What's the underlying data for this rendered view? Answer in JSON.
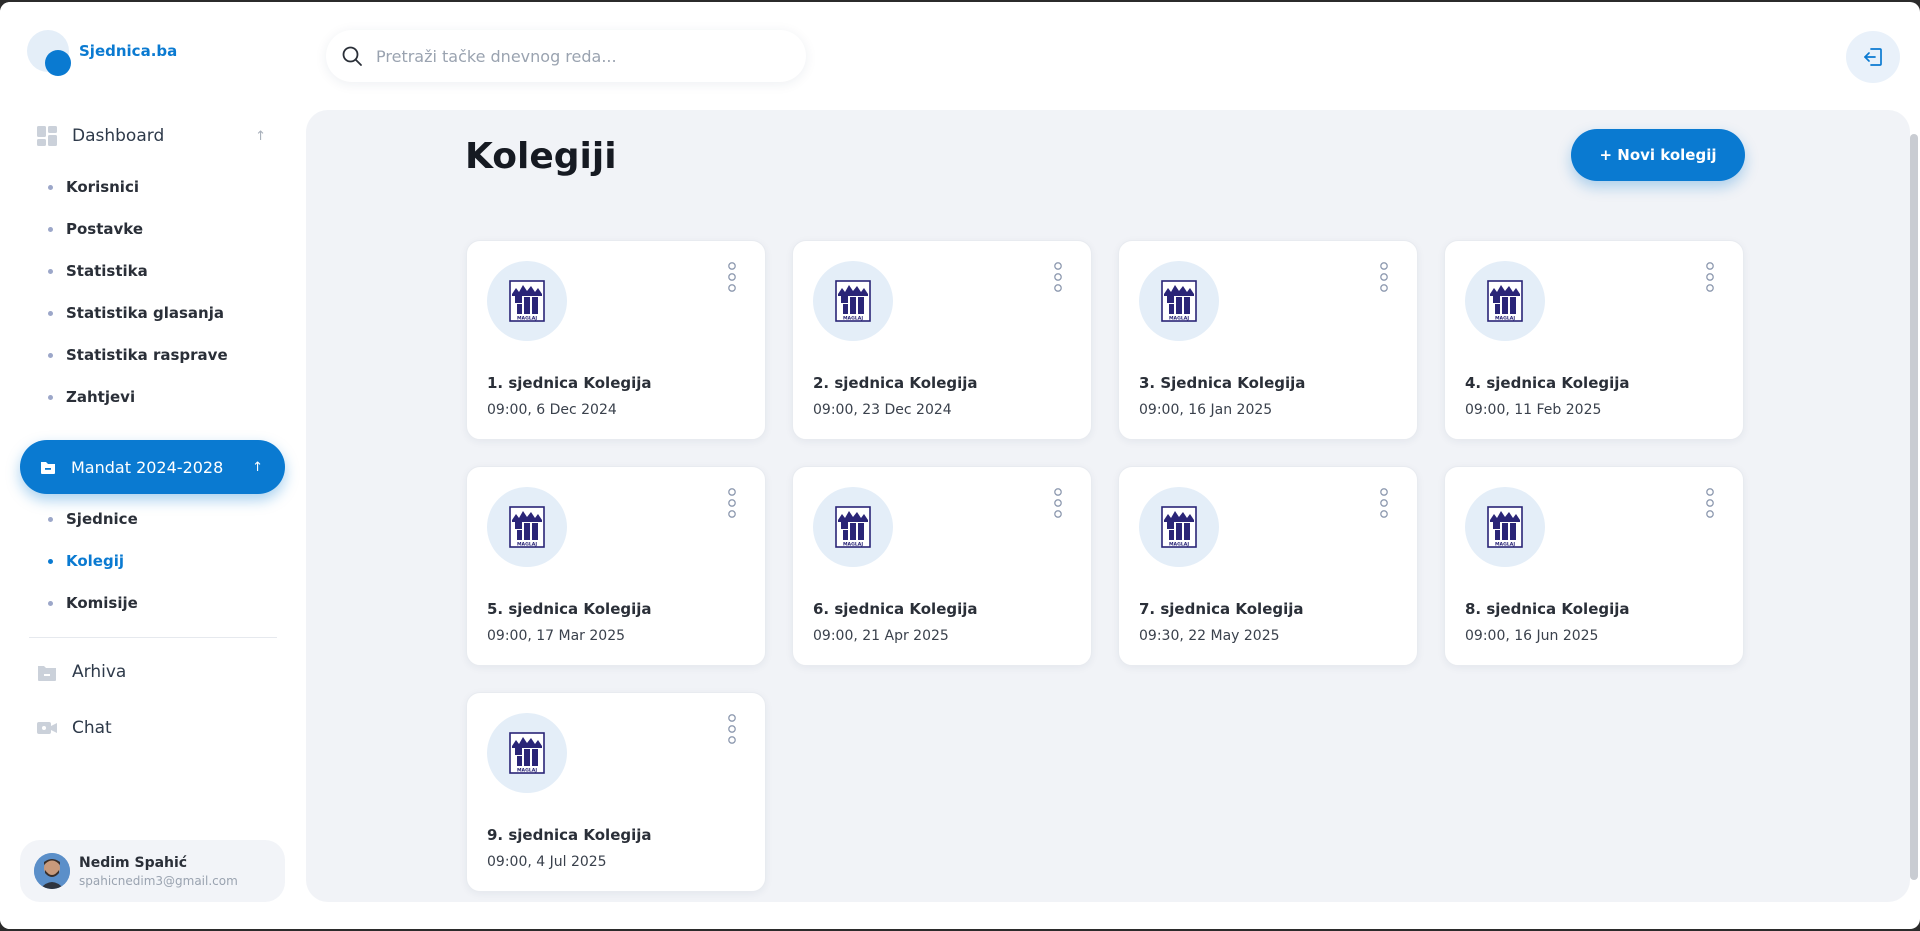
{
  "brand": "Sjednica.ba",
  "search": {
    "placeholder": "Pretraži tačke dnevnog reda..."
  },
  "sidebar": {
    "dashboard": {
      "label": "Dashboard"
    },
    "dashboard_items": [
      "Korisnici",
      "Postavke",
      "Statistika",
      "Statistika glasanja",
      "Statistika rasprave",
      "Zahtjevi"
    ],
    "mandat": {
      "label": "Mandat 2024-2028"
    },
    "mandat_items": [
      "Sjednice",
      "Kolegij",
      "Komisije"
    ],
    "mandat_active": "Kolegij",
    "arhiva": {
      "label": "Arhiva"
    },
    "chat": {
      "label": "Chat"
    }
  },
  "user": {
    "name": "Nedim Spahić",
    "email": "spahicnedim3@gmail.com"
  },
  "main": {
    "title": "Kolegiji",
    "new_button": "+ Novi kolegij",
    "cards": [
      {
        "title": "1. sjednica Kolegija",
        "time": "09:00, 6 Dec 2024"
      },
      {
        "title": "2. sjednica Kolegija",
        "time": "09:00, 23 Dec 2024"
      },
      {
        "title": "3. Sjednica Kolegija",
        "time": "09:00, 16 Jan 2025"
      },
      {
        "title": "4. sjednica Kolegija",
        "time": "09:00, 11 Feb 2025"
      },
      {
        "title": "5. sjednica Kolegija",
        "time": "09:00, 17 Mar 2025"
      },
      {
        "title": "6. sjednica Kolegija",
        "time": "09:00, 21 Apr 2025"
      },
      {
        "title": "7. sjednica Kolegija",
        "time": "09:30, 22 May 2025"
      },
      {
        "title": "8. sjednica Kolegija",
        "time": "09:00, 16 Jun 2025"
      },
      {
        "title": "9. sjednica Kolegija",
        "time": "09:00, 4 Jul 2025"
      }
    ],
    "card_logo_text": "MAGLAJ"
  },
  "colors": {
    "accent": "#0a7ad1",
    "background": "#f1f3f7",
    "logo_navy": "#2a2577"
  }
}
